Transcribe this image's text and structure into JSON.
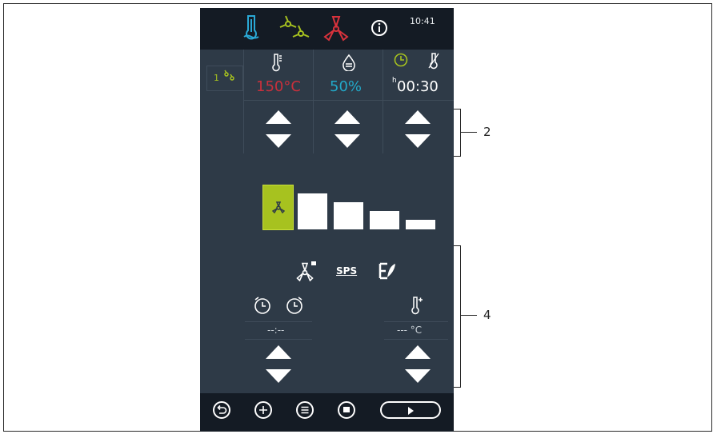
{
  "topbar": {
    "time": "10:41",
    "icons": [
      "steam-icon",
      "hot-air-icon",
      "combi-icon",
      "info-icon"
    ]
  },
  "params": {
    "stage_number": "1",
    "temperature": "150°C",
    "humidity": "50%",
    "time_prefix": "h",
    "time": "00:30"
  },
  "fan_levels": {
    "selected": 1,
    "count": 5
  },
  "options": {
    "sps_label": "SPS",
    "delay_value": "--:--",
    "core_temp_value": "--- °C"
  },
  "callouts": {
    "arrows_label": "2",
    "options_label": "4"
  },
  "colors": {
    "temperature": "#c8303c",
    "humidity": "#22a8c8",
    "accent": "#a7c21f",
    "steam": "#2aa9d6",
    "combi": "#d9323c"
  }
}
